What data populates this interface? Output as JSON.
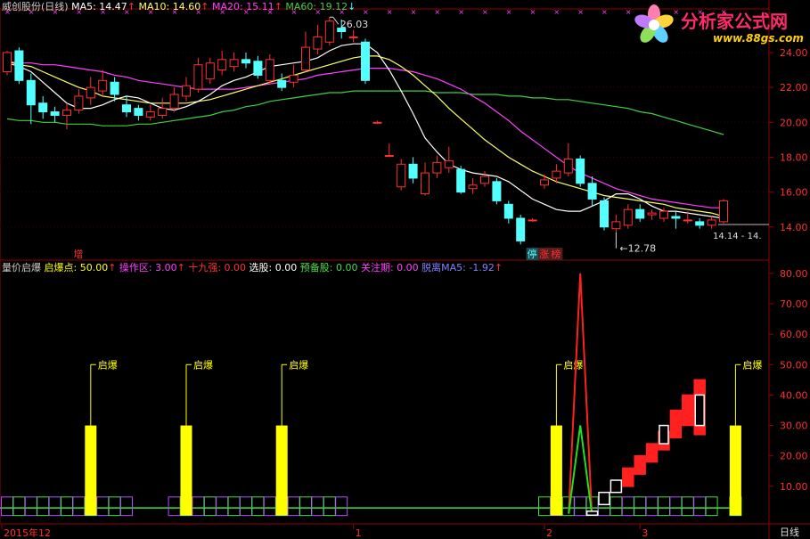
{
  "header_top": {
    "stock": "威创股份(日线)",
    "ma5": "MA5: 14.47",
    "ma10": "MA10: 14.60",
    "ma20": "MA20: 15.11",
    "ma60": "MA60: 19.12"
  },
  "header_bottom": {
    "name": "量价启爆",
    "qbd": "启爆点: 50.00",
    "czq": "操作区: 3.00",
    "sjq": "十九强: 0.00",
    "xg": "选股: 0.00",
    "ybg": "预备股: 0.00",
    "gzq": "关注期: 0.00",
    "tl": "脱离MA5: -1.92"
  },
  "logo": {
    "name": "分析家公式网",
    "url": "www.88gs.com"
  },
  "colors": {
    "up": "#ff3030",
    "down": "#54ffff",
    "ma5": "#ffffff",
    "ma10": "#ffff66",
    "ma20": "#ff40ff",
    "ma60": "#40d040",
    "yellow": "#ffff00",
    "grid": "#900000"
  },
  "chart_data": [
    {
      "type": "candlestick",
      "title": "威创股份(日线)",
      "y_ticks": [
        "24.00",
        "22.00",
        "20.00",
        "18.00",
        "16.00",
        "14.00"
      ],
      "ylim": [
        12.2,
        26.4
      ],
      "annotations": {
        "high": "26.03",
        "low": "12.78",
        "last": "14.14 - 14."
      },
      "markers": [
        "增",
        "停",
        "涨",
        "榜"
      ],
      "candles": [
        {
          "o": 22.9,
          "c": 24.0,
          "h": 24.1,
          "l": 22.7
        },
        {
          "o": 24.1,
          "c": 22.4,
          "h": 24.3,
          "l": 22.2
        },
        {
          "o": 22.4,
          "c": 21.0,
          "h": 22.8,
          "l": 19.9
        },
        {
          "o": 21.1,
          "c": 20.6,
          "h": 21.5,
          "l": 20.2
        },
        {
          "o": 20.6,
          "c": 20.4,
          "h": 20.9,
          "l": 20.0
        },
        {
          "o": 20.4,
          "c": 20.7,
          "h": 21.1,
          "l": 19.6
        },
        {
          "o": 20.7,
          "c": 21.5,
          "h": 21.9,
          "l": 20.5
        },
        {
          "o": 21.4,
          "c": 22.0,
          "h": 22.6,
          "l": 21.0
        },
        {
          "o": 21.8,
          "c": 22.4,
          "h": 23.0,
          "l": 21.5
        },
        {
          "o": 22.3,
          "c": 21.6,
          "h": 22.6,
          "l": 21.2
        },
        {
          "o": 21.0,
          "c": 20.6,
          "h": 21.5,
          "l": 20.3
        },
        {
          "o": 20.8,
          "c": 20.4,
          "h": 21.0,
          "l": 20.1
        },
        {
          "o": 20.3,
          "c": 20.6,
          "h": 21.0,
          "l": 20.1
        },
        {
          "o": 20.4,
          "c": 20.8,
          "h": 21.4,
          "l": 20.2
        },
        {
          "o": 20.8,
          "c": 21.6,
          "h": 22.0,
          "l": 20.6
        },
        {
          "o": 21.5,
          "c": 22.1,
          "h": 22.6,
          "l": 21.2
        },
        {
          "o": 21.9,
          "c": 23.3,
          "h": 23.7,
          "l": 21.7
        },
        {
          "o": 22.5,
          "c": 23.4,
          "h": 23.7,
          "l": 22.2
        },
        {
          "o": 23.0,
          "c": 23.6,
          "h": 24.1,
          "l": 22.7
        },
        {
          "o": 23.2,
          "c": 23.6,
          "h": 24.0,
          "l": 22.9
        },
        {
          "o": 23.6,
          "c": 23.4,
          "h": 24.0,
          "l": 23.1
        },
        {
          "o": 23.5,
          "c": 22.7,
          "h": 23.8,
          "l": 22.5
        },
        {
          "o": 22.4,
          "c": 23.6,
          "h": 23.9,
          "l": 22.2
        },
        {
          "o": 22.4,
          "c": 22.0,
          "h": 22.8,
          "l": 21.8
        },
        {
          "o": 22.3,
          "c": 22.7,
          "h": 23.3,
          "l": 22.0
        },
        {
          "o": 23.0,
          "c": 24.3,
          "h": 25.2,
          "l": 22.9
        },
        {
          "o": 24.2,
          "c": 24.9,
          "h": 25.6,
          "l": 23.9
        },
        {
          "o": 24.6,
          "c": 25.8,
          "h": 26.03,
          "l": 24.4
        },
        {
          "o": 25.4,
          "c": 25.2,
          "h": 25.9,
          "l": 24.8
        },
        {
          "o": 24.9,
          "c": 24.9,
          "h": 25.3,
          "l": 24.6
        },
        {
          "o": 24.6,
          "c": 22.4,
          "h": 24.8,
          "l": 22.2
        },
        {
          "o": 20.0,
          "c": 20.0,
          "h": 20.1,
          "l": 19.9
        },
        {
          "o": 18.1,
          "c": 18.1,
          "h": 18.8,
          "l": 18.0
        },
        {
          "o": 16.3,
          "c": 17.6,
          "h": 17.9,
          "l": 16.1
        },
        {
          "o": 17.6,
          "c": 16.8,
          "h": 18.0,
          "l": 16.5
        },
        {
          "o": 15.9,
          "c": 17.1,
          "h": 17.7,
          "l": 15.8
        },
        {
          "o": 17.1,
          "c": 17.7,
          "h": 18.1,
          "l": 16.8
        },
        {
          "o": 17.4,
          "c": 17.8,
          "h": 18.6,
          "l": 17.1
        },
        {
          "o": 17.3,
          "c": 16.0,
          "h": 17.5,
          "l": 15.9
        },
        {
          "o": 16.2,
          "c": 16.4,
          "h": 16.8,
          "l": 15.9
        },
        {
          "o": 16.5,
          "c": 16.9,
          "h": 17.2,
          "l": 16.3
        },
        {
          "o": 16.6,
          "c": 15.5,
          "h": 16.8,
          "l": 15.3
        },
        {
          "o": 15.3,
          "c": 14.5,
          "h": 15.5,
          "l": 14.2
        },
        {
          "o": 14.5,
          "c": 13.2,
          "h": 14.7,
          "l": 13.0
        },
        {
          "o": 14.4,
          "c": 14.4,
          "h": 14.5,
          "l": 14.3
        },
        {
          "o": 16.4,
          "c": 16.7,
          "h": 17.0,
          "l": 16.2
        },
        {
          "o": 16.8,
          "c": 17.2,
          "h": 17.6,
          "l": 16.5
        },
        {
          "o": 17.1,
          "c": 17.9,
          "h": 18.8,
          "l": 16.9
        },
        {
          "o": 17.9,
          "c": 16.5,
          "h": 18.1,
          "l": 16.3
        },
        {
          "o": 16.5,
          "c": 15.6,
          "h": 16.9,
          "l": 15.2
        },
        {
          "o": 15.5,
          "c": 14.0,
          "h": 15.7,
          "l": 13.8
        },
        {
          "o": 13.9,
          "c": 14.3,
          "h": 14.7,
          "l": 13.7
        },
        {
          "o": 14.1,
          "c": 15.0,
          "h": 15.3,
          "l": 13.9
        },
        {
          "o": 15.0,
          "c": 14.5,
          "h": 15.3,
          "l": 14.3
        },
        {
          "o": 14.7,
          "c": 14.8,
          "h": 15.0,
          "l": 14.4
        },
        {
          "o": 14.5,
          "c": 14.9,
          "h": 15.1,
          "l": 14.3
        },
        {
          "o": 14.6,
          "c": 14.5,
          "h": 14.9,
          "l": 13.9
        },
        {
          "o": 14.4,
          "c": 14.4,
          "h": 14.9,
          "l": 14.2
        },
        {
          "o": 14.3,
          "c": 14.1,
          "h": 14.5,
          "l": 13.9
        },
        {
          "o": 14.1,
          "c": 14.4,
          "h": 14.6,
          "l": 13.9
        },
        {
          "o": 14.3,
          "c": 15.5,
          "h": 15.6,
          "l": 14.2
        }
      ],
      "ma5": [
        23.4,
        23.2,
        22.9,
        22.3,
        21.7,
        21.1,
        20.8,
        20.8,
        21.0,
        21.3,
        21.5,
        21.4,
        21.1,
        20.8,
        20.7,
        20.9,
        21.2,
        21.6,
        22.1,
        22.4,
        22.6,
        22.9,
        23.2,
        23.3,
        23.4,
        23.5,
        23.7,
        24.1,
        24.4,
        24.5,
        24.5,
        24.0,
        23.0,
        21.8,
        20.5,
        19.1,
        18.3,
        17.6,
        17.3,
        17.1,
        17.0,
        16.9,
        16.6,
        16.1,
        15.6,
        15.3,
        15.0,
        14.9,
        14.9,
        15.2,
        15.5,
        15.9,
        15.9,
        15.6,
        15.2,
        14.9,
        14.9,
        14.8,
        14.7,
        14.6,
        14.5
      ],
      "ma10": [
        23.5,
        23.3,
        23.2,
        22.9,
        22.6,
        22.3,
        22.0,
        21.8,
        21.5,
        21.4,
        21.3,
        21.2,
        21.1,
        21.1,
        21.1,
        21.1,
        21.2,
        21.3,
        21.5,
        21.7,
        21.9,
        22.1,
        22.3,
        22.5,
        22.7,
        22.9,
        23.1,
        23.3,
        23.5,
        23.7,
        23.8,
        23.8,
        23.6,
        23.2,
        22.7,
        22.1,
        21.5,
        20.8,
        20.2,
        19.6,
        19.0,
        18.5,
        18.0,
        17.6,
        17.2,
        16.9,
        16.6,
        16.4,
        16.2,
        16.0,
        15.8,
        15.7,
        15.6,
        15.5,
        15.4,
        15.3,
        15.1,
        15.0,
        14.9,
        14.8,
        14.6
      ],
      "ma20": [
        23.5,
        23.4,
        23.4,
        23.3,
        23.3,
        23.2,
        23.1,
        23.0,
        22.9,
        22.7,
        22.6,
        22.4,
        22.3,
        22.2,
        22.1,
        22.0,
        21.9,
        21.9,
        21.9,
        21.9,
        22.0,
        22.1,
        22.2,
        22.3,
        22.4,
        22.5,
        22.7,
        22.8,
        22.9,
        23.0,
        23.1,
        23.1,
        23.1,
        23.0,
        22.9,
        22.7,
        22.5,
        22.2,
        21.9,
        21.5,
        21.1,
        20.6,
        20.1,
        19.5,
        19.0,
        18.5,
        18.0,
        17.5,
        17.1,
        16.8,
        16.5,
        16.2,
        16.0,
        15.8,
        15.6,
        15.5,
        15.4,
        15.3,
        15.2,
        15.1,
        15.1
      ],
      "ma60": [
        20.2,
        20.1,
        20.1,
        20.0,
        20.0,
        19.9,
        19.9,
        19.9,
        19.8,
        19.8,
        19.8,
        19.9,
        19.9,
        20.0,
        20.1,
        20.2,
        20.3,
        20.4,
        20.6,
        20.7,
        20.9,
        21.0,
        21.2,
        21.3,
        21.4,
        21.5,
        21.6,
        21.7,
        21.7,
        21.8,
        21.8,
        21.8,
        21.8,
        21.8,
        21.8,
        21.8,
        21.7,
        21.7,
        21.7,
        21.6,
        21.6,
        21.6,
        21.5,
        21.5,
        21.4,
        21.4,
        21.3,
        21.3,
        21.2,
        21.1,
        21.0,
        20.9,
        20.8,
        20.6,
        20.5,
        20.3,
        20.1,
        19.9,
        19.7,
        19.5,
        19.3
      ]
    },
    {
      "type": "bar",
      "title": "量价启爆",
      "y_ticks": [
        "80.00",
        "70.00",
        "60.00",
        "50.00",
        "40.00",
        "30.00",
        "20.00",
        "10.00"
      ],
      "ylim": [
        0,
        82
      ],
      "series": [
        {
          "name": "启爆点",
          "label": "启爆",
          "bars": [
            {
              "i": 7,
              "v": 30,
              "lv": 50
            },
            {
              "i": 15,
              "v": 30,
              "lv": 50
            },
            {
              "i": 23,
              "v": 30,
              "lv": 50
            },
            {
              "i": 46,
              "v": 30,
              "lv": 50
            },
            {
              "i": 61,
              "v": 30,
              "lv": 50
            }
          ]
        },
        {
          "name": "十九强",
          "spikes": [
            {
              "i": 48,
              "v": 80,
              "color": "#ff2020"
            },
            {
              "i": 48,
              "v": 30,
              "color": "#20e020"
            }
          ]
        },
        {
          "name": "选股",
          "boxes": [
            {
              "i": 49,
              "lo": 0.5,
              "hi": 1.8,
              "color": "#ffffff"
            },
            {
              "i": 50,
              "lo": 4,
              "hi": 8,
              "color": "#ffffff"
            },
            {
              "i": 51,
              "lo": 8,
              "hi": 12,
              "color": "#ffffff"
            },
            {
              "i": 52,
              "lo": 10,
              "hi": 16,
              "color": "#ff2020"
            },
            {
              "i": 53,
              "lo": 14,
              "hi": 20,
              "color": "#ff2020"
            },
            {
              "i": 54,
              "lo": 18,
              "hi": 24,
              "color": "#ff2020"
            },
            {
              "i": 55,
              "lo": 22,
              "hi": 28,
              "color": "#ff2020"
            },
            {
              "i": 56,
              "lo": 26,
              "hi": 35,
              "color": "#ff2020"
            },
            {
              "i": 57,
              "lo": 30,
              "hi": 40,
              "color": "#ff2020"
            },
            {
              "i": 58,
              "lo": 27,
              "hi": 45,
              "color": "#ff2020"
            }
          ]
        }
      ],
      "footer_boxes": [
        {
          "from": 0,
          "to": 10,
          "color": "#b050ff"
        },
        {
          "from": 14,
          "to": 28,
          "color": "#b050ff"
        },
        {
          "from": 45,
          "to": 59,
          "color": "#b050ff"
        },
        {
          "from": 61,
          "to": 61,
          "color": "#b050ff"
        }
      ]
    }
  ],
  "x_axis": {
    "labels": [
      {
        "i": 0,
        "t": "2015年12"
      },
      {
        "i": 29,
        "t": "1"
      },
      {
        "i": 45,
        "t": "2"
      },
      {
        "i": 53,
        "t": "3"
      }
    ],
    "period": "日线"
  }
}
